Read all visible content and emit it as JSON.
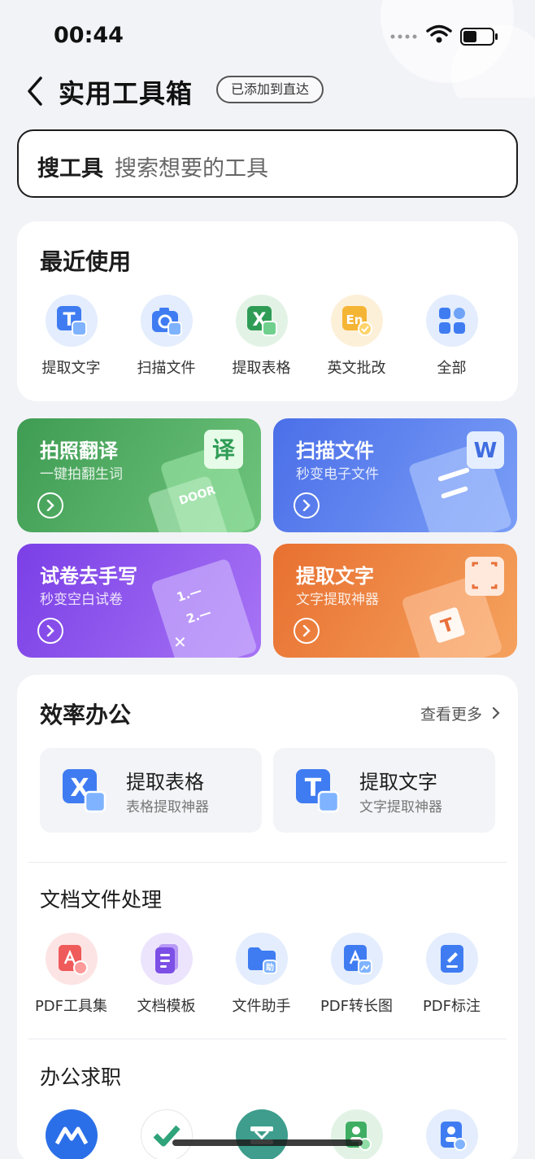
{
  "status_bar": {
    "time": "00:44"
  },
  "nav": {
    "title": "实用工具箱",
    "added_label": "已添加到直达"
  },
  "search": {
    "label": "搜工具",
    "placeholder": "搜索想要的工具"
  },
  "recent": {
    "title": "最近使用",
    "items": [
      {
        "label": "提取文字",
        "icon": "text-extract-icon"
      },
      {
        "label": "扫描文件",
        "icon": "scan-camera-icon"
      },
      {
        "label": "提取表格",
        "icon": "excel-extract-icon"
      },
      {
        "label": "英文批改",
        "icon": "english-correct-icon"
      },
      {
        "label": "全部",
        "icon": "grid-all-icon"
      }
    ]
  },
  "features": [
    {
      "title": "拍照翻译",
      "subtitle": "一键拍翻生词",
      "color": "#4caa5f",
      "art_text": "译"
    },
    {
      "title": "扫描文件",
      "subtitle": "秒变电子文件",
      "color": "#5a7ff0",
      "art_text": "W"
    },
    {
      "title": "试卷去手写",
      "subtitle": "秒变空白试卷",
      "color": "#8e52f0",
      "art_text": "1.—"
    },
    {
      "title": "提取文字",
      "subtitle": "文字提取神器",
      "color": "#ef8442",
      "art_text": "T"
    }
  ],
  "office": {
    "title": "效率办公",
    "see_more": "查看更多",
    "big_tiles": [
      {
        "title": "提取表格",
        "subtitle": "表格提取神器",
        "icon": "excel-extract-icon"
      },
      {
        "title": "提取文字",
        "subtitle": "文字提取神器",
        "icon": "text-extract-icon"
      }
    ],
    "doc_section": {
      "title": "文档文件处理",
      "items": [
        {
          "label": "PDF工具集",
          "icon": "pdf-tools-icon"
        },
        {
          "label": "文档模板",
          "icon": "doc-template-icon"
        },
        {
          "label": "文件助手",
          "icon": "file-helper-icon"
        },
        {
          "label": "PDF转长图",
          "icon": "pdf-to-image-icon"
        },
        {
          "label": "PDF标注",
          "icon": "pdf-annotate-icon"
        }
      ]
    },
    "job_section": {
      "title": "办公求职",
      "items": [
        {
          "icon": "mountain-logo-icon"
        },
        {
          "icon": "check-logo-icon"
        },
        {
          "icon": "binder-icon"
        },
        {
          "icon": "resume-star-icon"
        },
        {
          "icon": "id-photo-icon"
        }
      ]
    },
    "doc_helper_badge": "助"
  }
}
